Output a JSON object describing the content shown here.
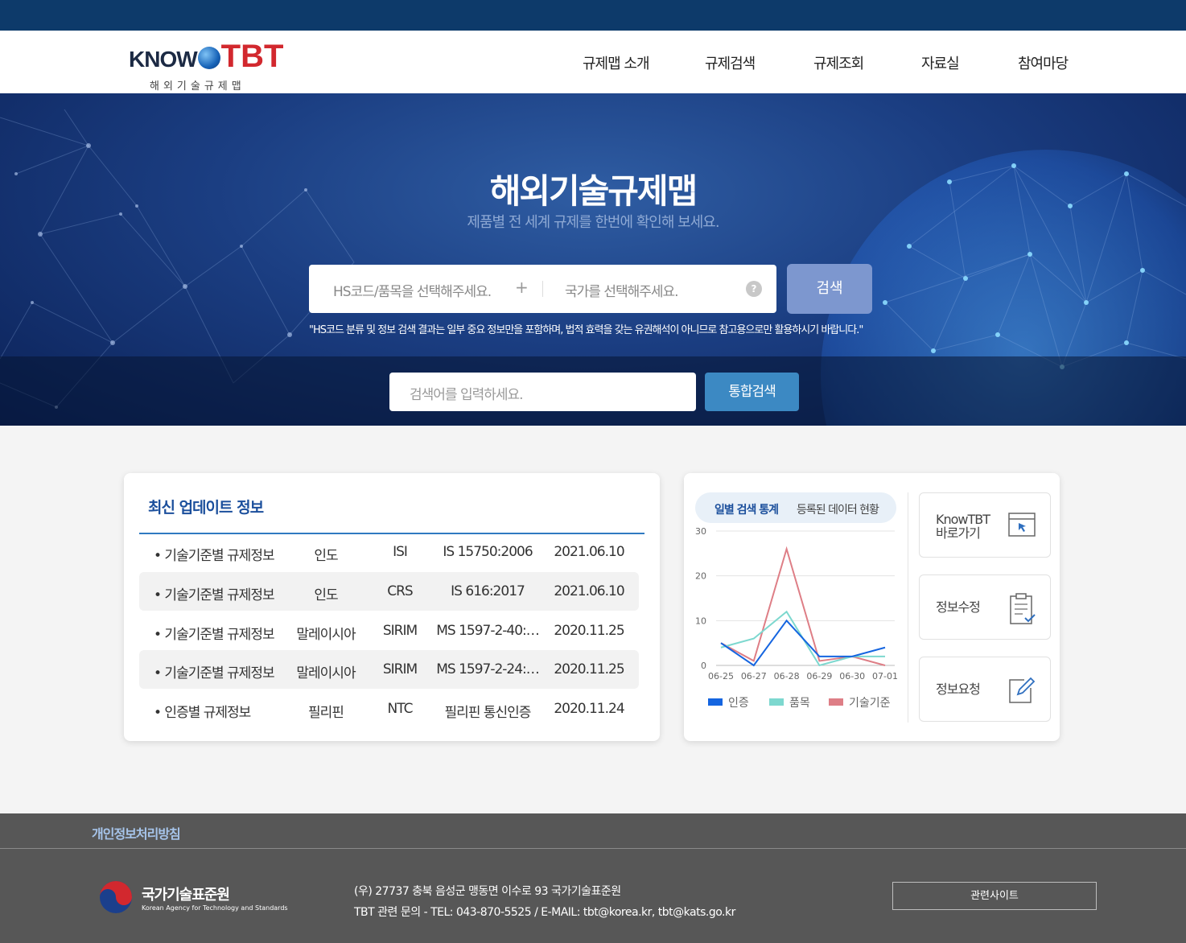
{
  "header": {
    "logo": {
      "brand_left": "KNOW",
      "brand_right": "TBT",
      "tagline": "해외기술규제맵"
    },
    "nav": [
      "규제맵 소개",
      "규제검색",
      "규제조회",
      "자료실",
      "참여마당"
    ]
  },
  "hero": {
    "title": "해외기술규제맵",
    "subtitle": "제품별 전 세계 규제를 한번에 확인해 보세요.",
    "hs_placeholder": "HS코드/품목을 선택해주세요.",
    "plus": "+",
    "country_placeholder": "국가를 선택해주세요.",
    "help": "?",
    "search_button": "검색",
    "notice": "\"HS코드 분류 및 정보 검색 결과는 일부 중요 정보만을 포함하며, 법적 효력을 갖는 유권해석이 아니므로 참고용으로만 활용하시기 바랍니다.\"",
    "total_placeholder": "검색어를 입력하세요.",
    "total_button": "통합검색"
  },
  "updates": {
    "title": "최신 업데이트 정보",
    "rows": [
      {
        "category": "• 기술기준별 규제정보",
        "country": "인도",
        "org": "ISI",
        "code": "IS 15750:2006",
        "date": "2021.06.10"
      },
      {
        "category": "• 기술기준별 규제정보",
        "country": "인도",
        "org": "CRS",
        "code": "IS 616:2017",
        "date": "2021.06.10"
      },
      {
        "category": "• 기술기준별 규제정보",
        "country": "말레이시아",
        "org": "SIRIM",
        "code": "MS 1597-2-40:…",
        "date": "2020.11.25"
      },
      {
        "category": "• 기술기준별 규제정보",
        "country": "말레이시아",
        "org": "SIRIM",
        "code": "MS 1597-2-24:…",
        "date": "2020.11.25"
      },
      {
        "category": "• 인증별 규제정보",
        "country": "필리핀",
        "org": "NTC",
        "code": "필리핀 통신인증",
        "date": "2020.11.24"
      }
    ]
  },
  "stats": {
    "tabs": {
      "daily": "일별 검색 통계",
      "registered": "등록된 데이터 현황"
    }
  },
  "chart_data": {
    "type": "line",
    "x": [
      "06-25",
      "06-27",
      "06-28",
      "06-29",
      "06-30",
      "07-01"
    ],
    "x_positions": [
      0,
      1,
      2,
      3,
      4,
      5
    ],
    "x_points": [
      0,
      1,
      2,
      3,
      4,
      5
    ],
    "series": [
      {
        "name": "인증",
        "color": "#1565e0",
        "x": [
          0,
          1,
          2,
          3,
          4,
          5
        ],
        "values": [
          5,
          0,
          10,
          2,
          2,
          4
        ]
      },
      {
        "name": "품목",
        "color": "#7dd8cf",
        "x": [
          0,
          1,
          2,
          3,
          4,
          5
        ],
        "values": [
          4,
          6,
          12,
          0,
          2,
          2
        ]
      },
      {
        "name": "기술기준",
        "color": "#de7e86",
        "x": [
          0,
          1,
          2,
          3,
          4,
          5
        ],
        "values": [
          5,
          1,
          26,
          1,
          2,
          0
        ]
      }
    ],
    "yticks": [
      0,
      10,
      20,
      30
    ],
    "ylim": [
      0,
      30
    ],
    "grid": true,
    "legend": "bottom"
  },
  "quick_links": [
    {
      "label_line1": "KnowTBT",
      "label_line2": "바로가기",
      "icon": "window-cursor-icon"
    },
    {
      "label_line1": "정보수정",
      "label_line2": "",
      "icon": "clipboard-check-icon"
    },
    {
      "label_line1": "정보요청",
      "label_line2": "",
      "icon": "edit-icon"
    }
  ],
  "footer": {
    "privacy": "개인정보처리방침",
    "org_ko": "국가기술표준원",
    "org_en": "Korean Agency for Technology and Standards",
    "address": "(우) 27737 충북 음성군 맹동면 이수로 93 국가기술표준원",
    "contact": "TBT 관련 문의 - TEL: 043-870-5525 / E-MAIL: tbt@korea.kr, tbt@kats.go.kr",
    "related_sites": "관련사이트"
  },
  "colors": {
    "topbar": "#0d3a6a",
    "accent_blue": "#1b4f9c",
    "search_button": "#7d97cf",
    "total_button": "#3c89c3",
    "footer": "#575757"
  }
}
